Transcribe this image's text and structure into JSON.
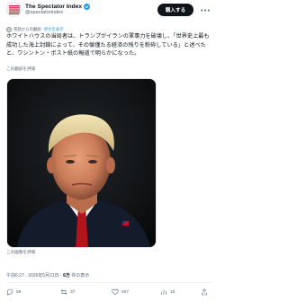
{
  "account": {
    "display_name": "The Spectator Index",
    "handle": "@spectatorindex",
    "subscribe_label": "購入する",
    "more_icon": "more-horizontal-icon",
    "verified_color": "#1d9bf0",
    "logo_color": "#c8102e"
  },
  "translation": {
    "label": "英語からの翻訳",
    "show_original": "原文を表示"
  },
  "tweet": {
    "text": "ホワイトハウスの当局者は、トランプがイランの軍事力を破壊し、「世界史上最も成功した海上封鎖によって、その懐僅たる経済の残りを粉砕している」と述べたと、ワシントン・ポスト紙の報道で明らかになった。",
    "rate_translation": "この翻訳を評価",
    "media_caption": "この画像を評価"
  },
  "meta": {
    "time_date": "午前6:27 · 2026年5月21日 ·",
    "views_count": "6万",
    "views_label": "件の表示"
  },
  "actions": {
    "reply_count": "56",
    "retweet_count": "37",
    "like_count": "207",
    "bookmark_count": "16"
  },
  "colors": {
    "text_primary": "#0f1419",
    "text_secondary": "#536471",
    "link": "#1d9bf0",
    "button_bg": "#0f1419"
  }
}
